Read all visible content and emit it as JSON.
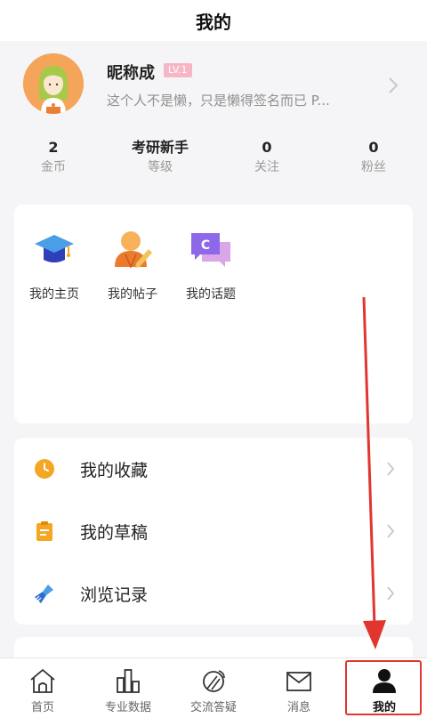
{
  "header": {
    "title": "我的"
  },
  "profile": {
    "nickname": "昵称成",
    "level": "LV.1",
    "signature": "这个人不是懒，只是懒得签名而已 P..."
  },
  "stats": [
    {
      "value": "2",
      "label": "金币"
    },
    {
      "value": "考研新手",
      "label": "等级"
    },
    {
      "value": "0",
      "label": "关注"
    },
    {
      "value": "0",
      "label": "粉丝"
    }
  ],
  "shortcuts": [
    {
      "label": "我的主页",
      "icon": "graduation-cap-icon"
    },
    {
      "label": "我的帖子",
      "icon": "user-edit-icon"
    },
    {
      "label": "我的话题",
      "icon": "topic-chat-icon"
    }
  ],
  "menu": [
    {
      "label": "我的收藏",
      "icon": "clock-icon"
    },
    {
      "label": "我的草稿",
      "icon": "clipboard-icon"
    },
    {
      "label": "浏览记录",
      "icon": "broom-icon"
    }
  ],
  "tabs": [
    {
      "label": "首页",
      "icon": "home-icon"
    },
    {
      "label": "专业数据",
      "icon": "bar-chart-icon"
    },
    {
      "label": "交流答疑",
      "icon": "compass-icon"
    },
    {
      "label": "消息",
      "icon": "mail-icon"
    },
    {
      "label": "我的",
      "icon": "person-icon",
      "active": true
    }
  ],
  "colors": {
    "accent_orange": "#f5a623",
    "badge_pink": "#f7b6c5",
    "highlight_red": "#e1362f",
    "topic_purple": "#8e68e8",
    "cap_blue": "#3b5bdb"
  }
}
